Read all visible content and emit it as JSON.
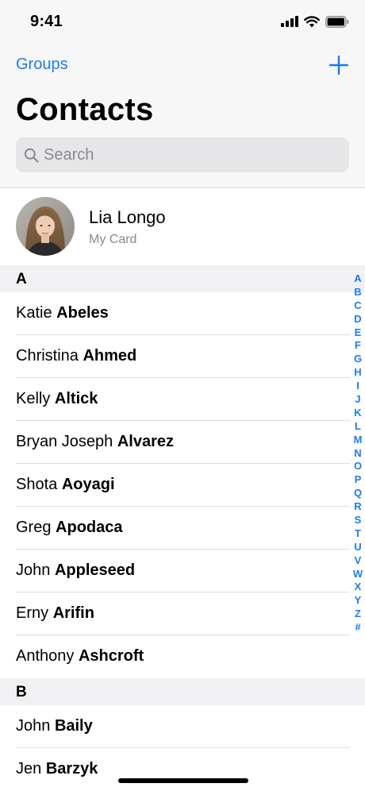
{
  "status_bar": {
    "time": "9:41"
  },
  "nav": {
    "groups_label": "Groups",
    "add_icon": "plus-icon",
    "title": "Contacts",
    "search_placeholder": "Search",
    "search_icon": "search-icon"
  },
  "my_card": {
    "name": "Lia Longo",
    "subtitle": "My Card"
  },
  "sections": [
    {
      "letter": "A",
      "contacts": [
        {
          "first": "Katie",
          "last": "Abeles"
        },
        {
          "first": "Christina",
          "last": "Ahmed"
        },
        {
          "first": "Kelly",
          "last": "Altick"
        },
        {
          "first": "Bryan Joseph",
          "last": "Alvarez"
        },
        {
          "first": "Shota",
          "last": "Aoyagi"
        },
        {
          "first": "Greg",
          "last": "Apodaca"
        },
        {
          "first": "John",
          "last": "Appleseed"
        },
        {
          "first": "Erny",
          "last": "Arifin"
        },
        {
          "first": "Anthony",
          "last": "Ashcroft"
        }
      ]
    },
    {
      "letter": "B",
      "contacts": [
        {
          "first": "John",
          "last": "Baily"
        },
        {
          "first": "Jen",
          "last": "Barzyk"
        }
      ]
    }
  ],
  "index_letters": [
    "A",
    "B",
    "C",
    "D",
    "E",
    "F",
    "G",
    "H",
    "I",
    "J",
    "K",
    "L",
    "M",
    "N",
    "O",
    "P",
    "Q",
    "R",
    "S",
    "T",
    "U",
    "V",
    "W",
    "X",
    "Y",
    "Z",
    "#"
  ],
  "colors": {
    "accent": "#1a7bf5",
    "secondary_text": "#8a8a8e",
    "header_bg": "#f7f7f7",
    "section_bg": "#f1f1f3"
  }
}
